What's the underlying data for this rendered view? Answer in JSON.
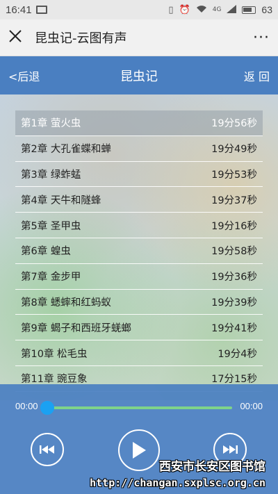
{
  "status_bar": {
    "time": "16:41",
    "network": "4G",
    "battery": "63"
  },
  "wechat_bar": {
    "title": "昆虫记-云图有声",
    "more": "···"
  },
  "header": {
    "back_label": "<后退",
    "title": "昆虫记",
    "return_label": "返 回"
  },
  "chapters": [
    {
      "title": "第1章  萤火虫",
      "duration": "19分56秒",
      "active": true
    },
    {
      "title": "第2章  大孔雀蝶和蝉",
      "duration": "19分49秒"
    },
    {
      "title": "第3章  绿蚱蜢",
      "duration": "19分53秒"
    },
    {
      "title": "第4章  天牛和隧蜂",
      "duration": "19分37秒"
    },
    {
      "title": "第5章  圣甲虫",
      "duration": "19分16秒"
    },
    {
      "title": "第6章  蝗虫",
      "duration": "19分58秒"
    },
    {
      "title": "第7章  金步甲",
      "duration": "19分36秒"
    },
    {
      "title": "第8章  蟋蟀和红蚂蚁",
      "duration": "19分39秒"
    },
    {
      "title": "第9章  蝎子和西班牙蜣螂",
      "duration": "19分41秒"
    },
    {
      "title": "第10章  松毛虫",
      "duration": "19分4秒"
    },
    {
      "title": "第11章  豌豆象",
      "duration": "17分15秒"
    }
  ],
  "player": {
    "current_time": "00:00",
    "total_time": "00:00",
    "progress": 0
  },
  "watermark": {
    "line1": "西安市长安区图书馆",
    "line2": "http://changan.sxplsc.org.cn"
  },
  "colors": {
    "header_blue": "#4a7fc1",
    "progress_green": "#7fd38a",
    "thumb_blue": "#1ba1f2"
  }
}
